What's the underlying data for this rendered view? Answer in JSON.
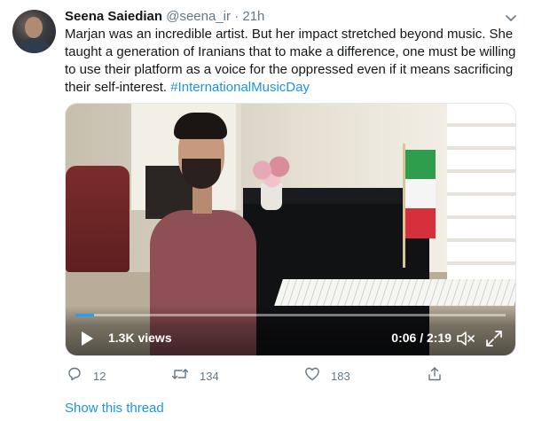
{
  "tweet": {
    "author_name": "Seena Saiedian",
    "handle": "@seena_ir",
    "separator": "·",
    "time": "21h",
    "text_body": "Marjan was an incredible artist. But her impact stretched beyond music. She taught a generation of Iranians that to make a difference, one must be willing to use their platform as a voice for the oppressed even if it means sacrificing their self-interest.",
    "hashtag": "#InternationalMusicDay",
    "avatar_icon": "profile-photo",
    "menu_icon": "chevron-down-icon"
  },
  "video": {
    "views": "1.3K views",
    "time_display": "0:06 / 2:19",
    "progress_fraction": 0.043,
    "play_icon": "play-icon",
    "mute_icon": "speaker-muted-icon",
    "fullscreen_icon": "fullscreen-icon"
  },
  "actions": {
    "reply_count": "12",
    "retweet_count": "134",
    "like_count": "183",
    "reply_icon": "reply-icon",
    "retweet_icon": "retweet-icon",
    "like_icon": "heart-icon",
    "share_icon": "share-icon"
  },
  "show_thread": "Show this thread",
  "colors": {
    "link": "#1b95e0",
    "muted_text": "#657786",
    "progress": "#1da1f2"
  }
}
